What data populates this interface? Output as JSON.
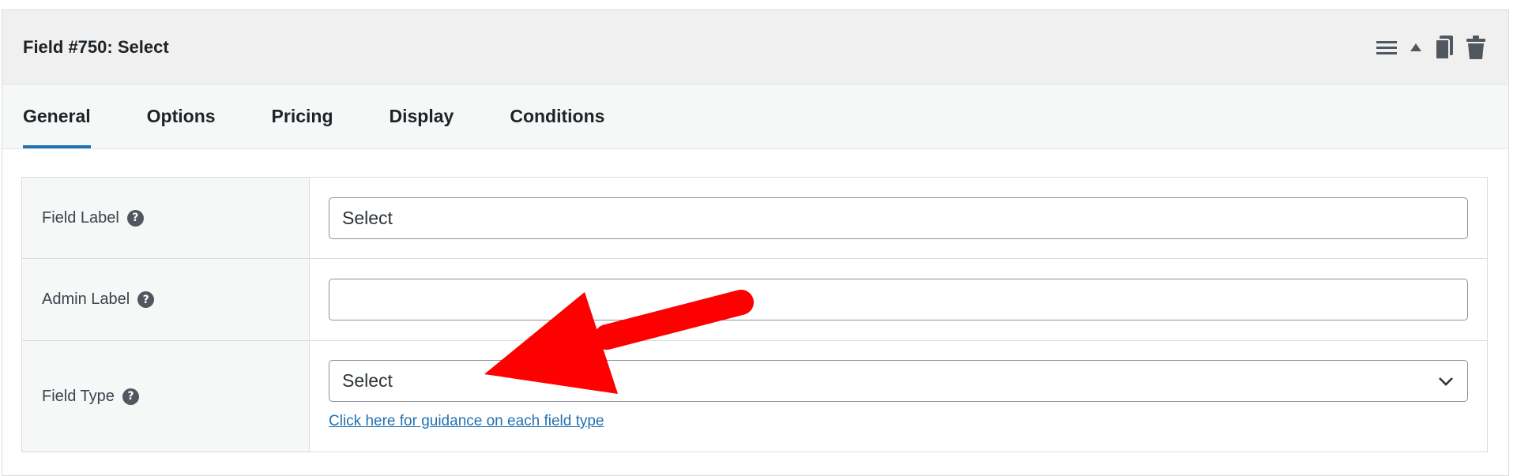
{
  "panel": {
    "title": "Field #750: Select",
    "actions": [
      {
        "icon": "hamburger-icon"
      },
      {
        "icon": "triangle-up-icon"
      },
      {
        "icon": "copy-icon"
      },
      {
        "icon": "trash-icon"
      }
    ]
  },
  "tabs": [
    {
      "label": "General",
      "active": true
    },
    {
      "label": "Options",
      "active": false
    },
    {
      "label": "Pricing",
      "active": false
    },
    {
      "label": "Display",
      "active": false
    },
    {
      "label": "Conditions",
      "active": false
    }
  ],
  "form": {
    "field_label": {
      "label": "Field Label",
      "value": "Select"
    },
    "admin_label": {
      "label": "Admin Label",
      "value": ""
    },
    "field_type": {
      "label": "Field Type",
      "value": "Select",
      "link": "Click here for guidance on each field type"
    }
  },
  "colors": {
    "accent": "#2271b1",
    "arrow": "#ff0000",
    "header_bg": "#f0f0f1"
  },
  "help_glyph": "?"
}
